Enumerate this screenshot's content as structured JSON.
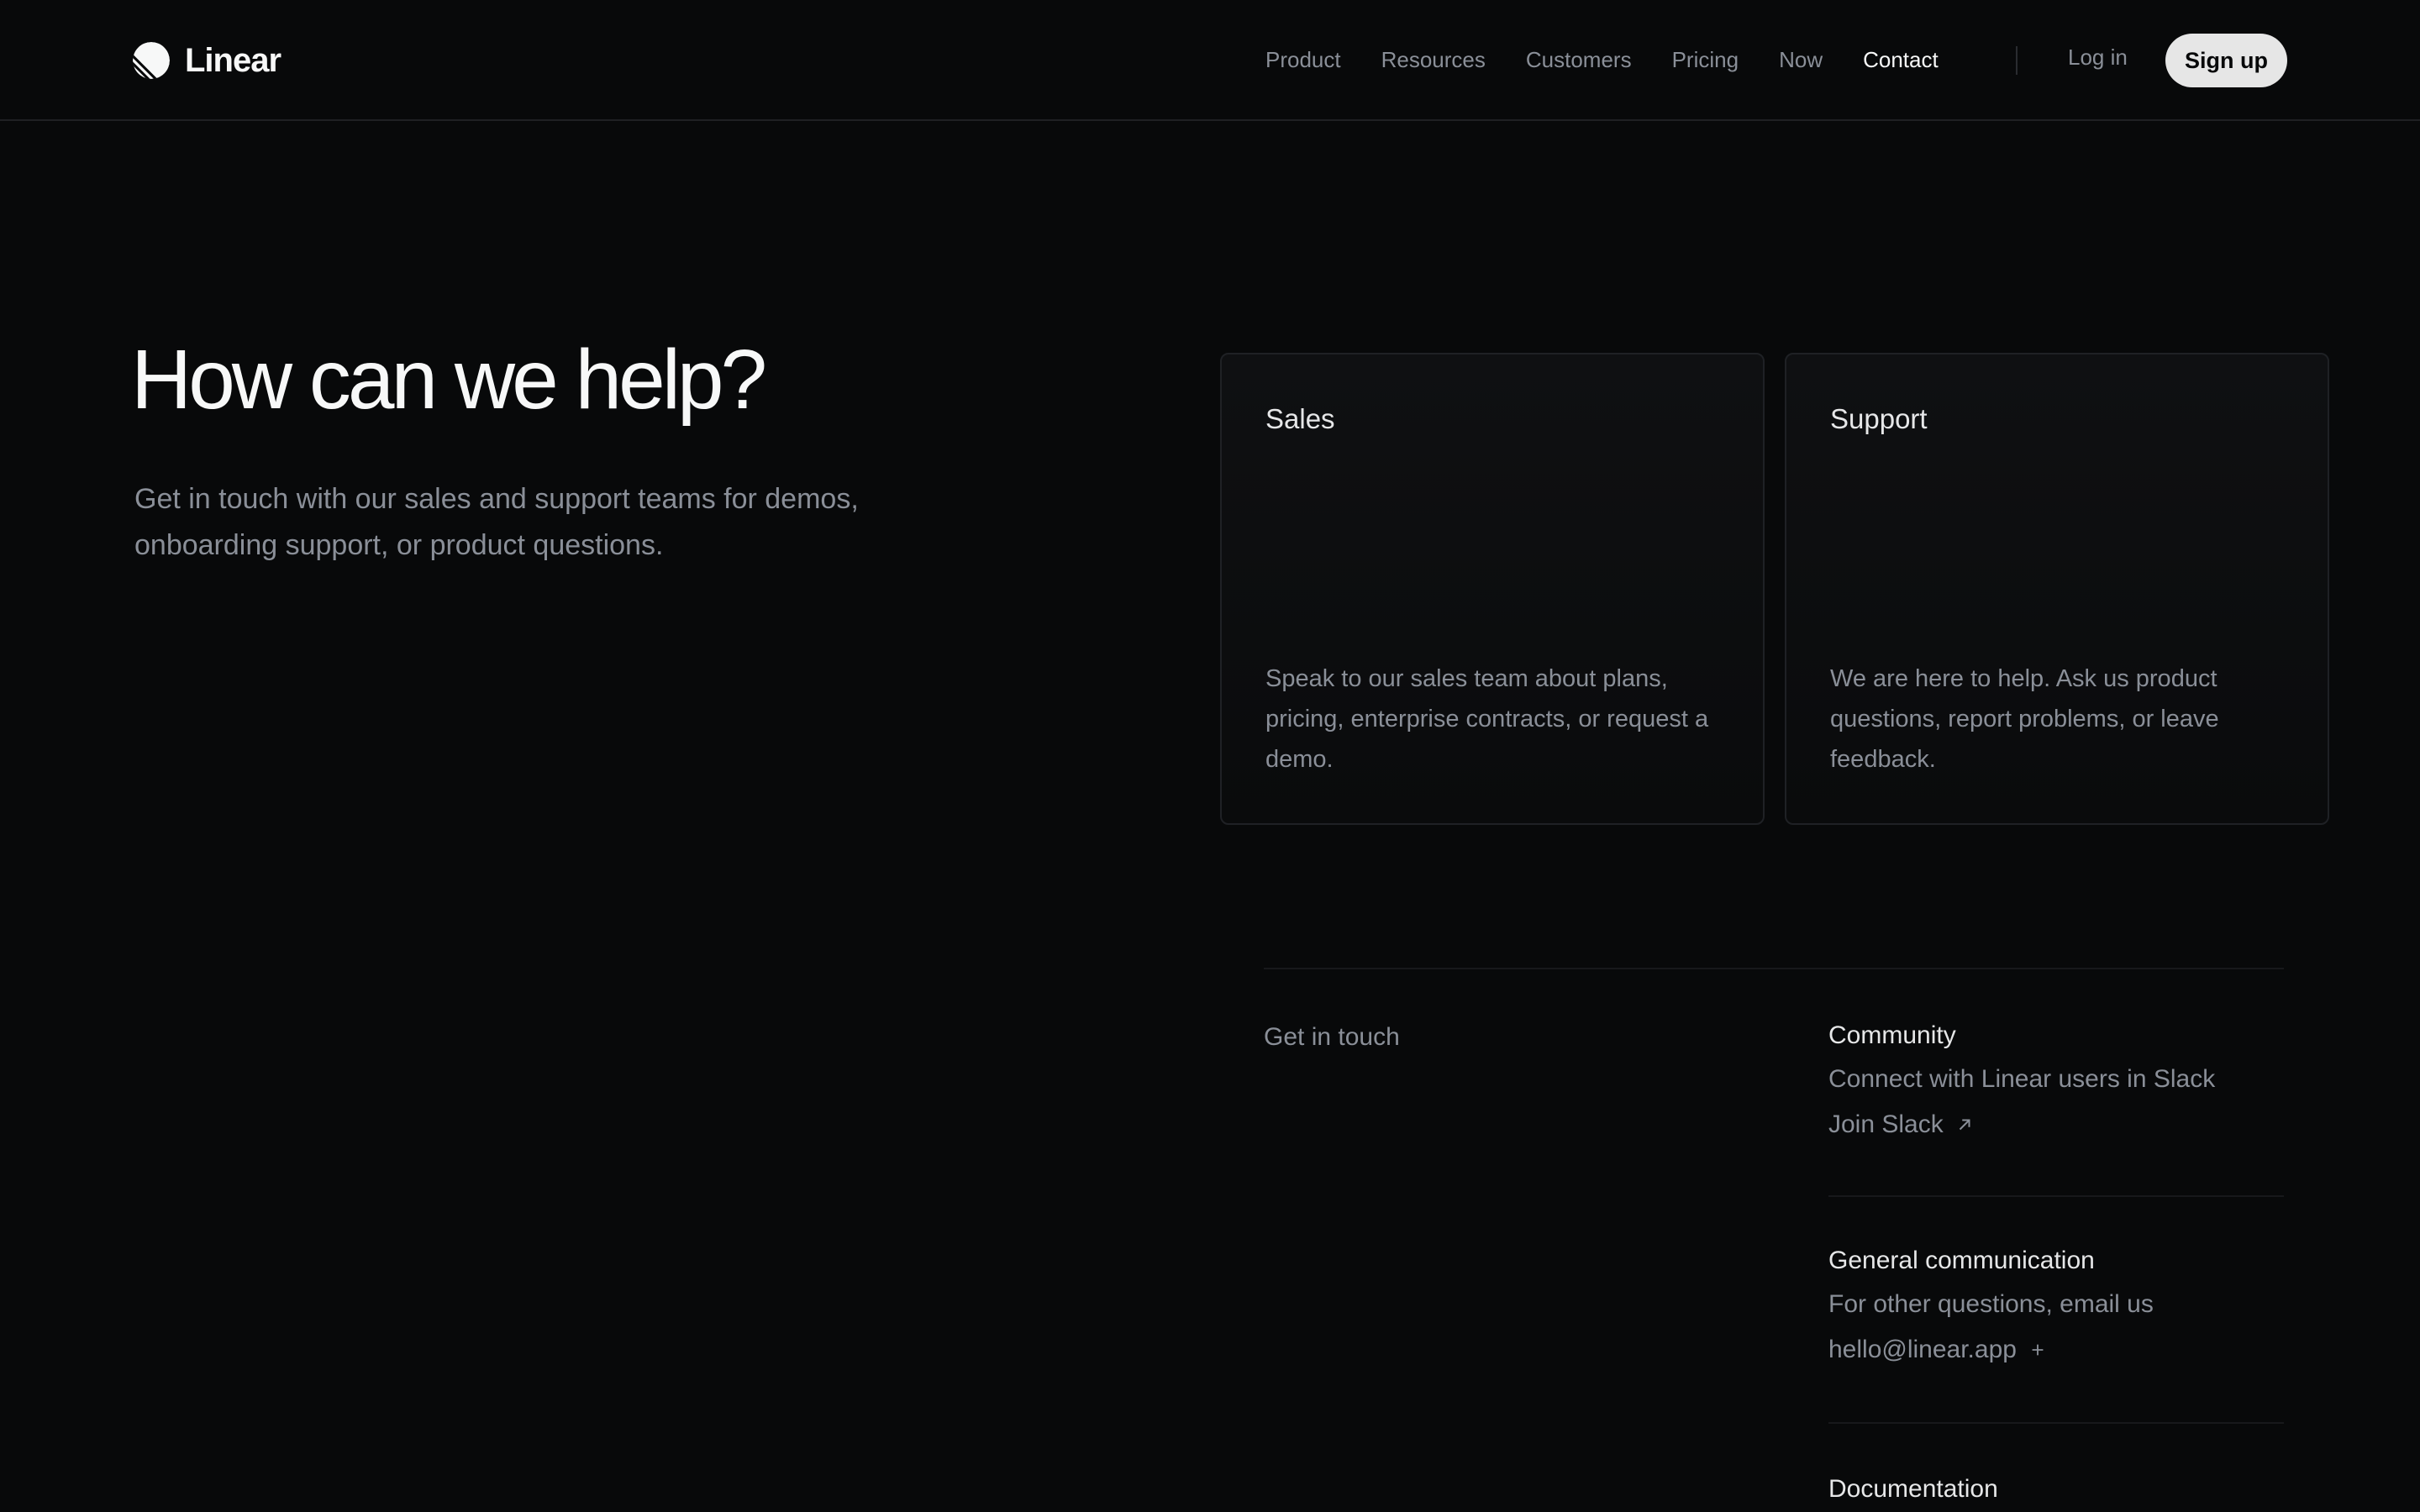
{
  "header": {
    "brand": "Linear",
    "nav": [
      {
        "label": "Product",
        "active": false
      },
      {
        "label": "Resources",
        "active": false
      },
      {
        "label": "Customers",
        "active": false
      },
      {
        "label": "Pricing",
        "active": false
      },
      {
        "label": "Now",
        "active": false
      },
      {
        "label": "Contact",
        "active": true
      }
    ],
    "login_label": "Log in",
    "signup_label": "Sign up"
  },
  "hero": {
    "title": "How can we help?",
    "description": "Get in touch with our sales and support teams for demos, onboarding support, or product questions."
  },
  "cards": {
    "sales": {
      "title": "Sales",
      "description": "Speak to our sales team about plans, pricing, enterprise contracts, or request a demo."
    },
    "support": {
      "title": "Support",
      "description": "We are here to help. Ask us product questions, report problems, or leave feedback."
    }
  },
  "contact": {
    "section_label": "Get in touch",
    "community": {
      "title": "Community",
      "description": "Connect with Linear users in Slack",
      "link_label": "Join Slack",
      "link_icon": "arrow-up-right-icon"
    },
    "general": {
      "title": "General communication",
      "description": "For other questions, email us",
      "link_label": "hello@linear.app",
      "link_icon": "plus-icon"
    },
    "documentation": {
      "title": "Documentation"
    }
  },
  "colors": {
    "background": "#08090a",
    "text_primary": "#f7f8f8",
    "text_secondary": "#8a8f98",
    "border": "#1f2125",
    "signup_bg": "#e6e6e6"
  }
}
